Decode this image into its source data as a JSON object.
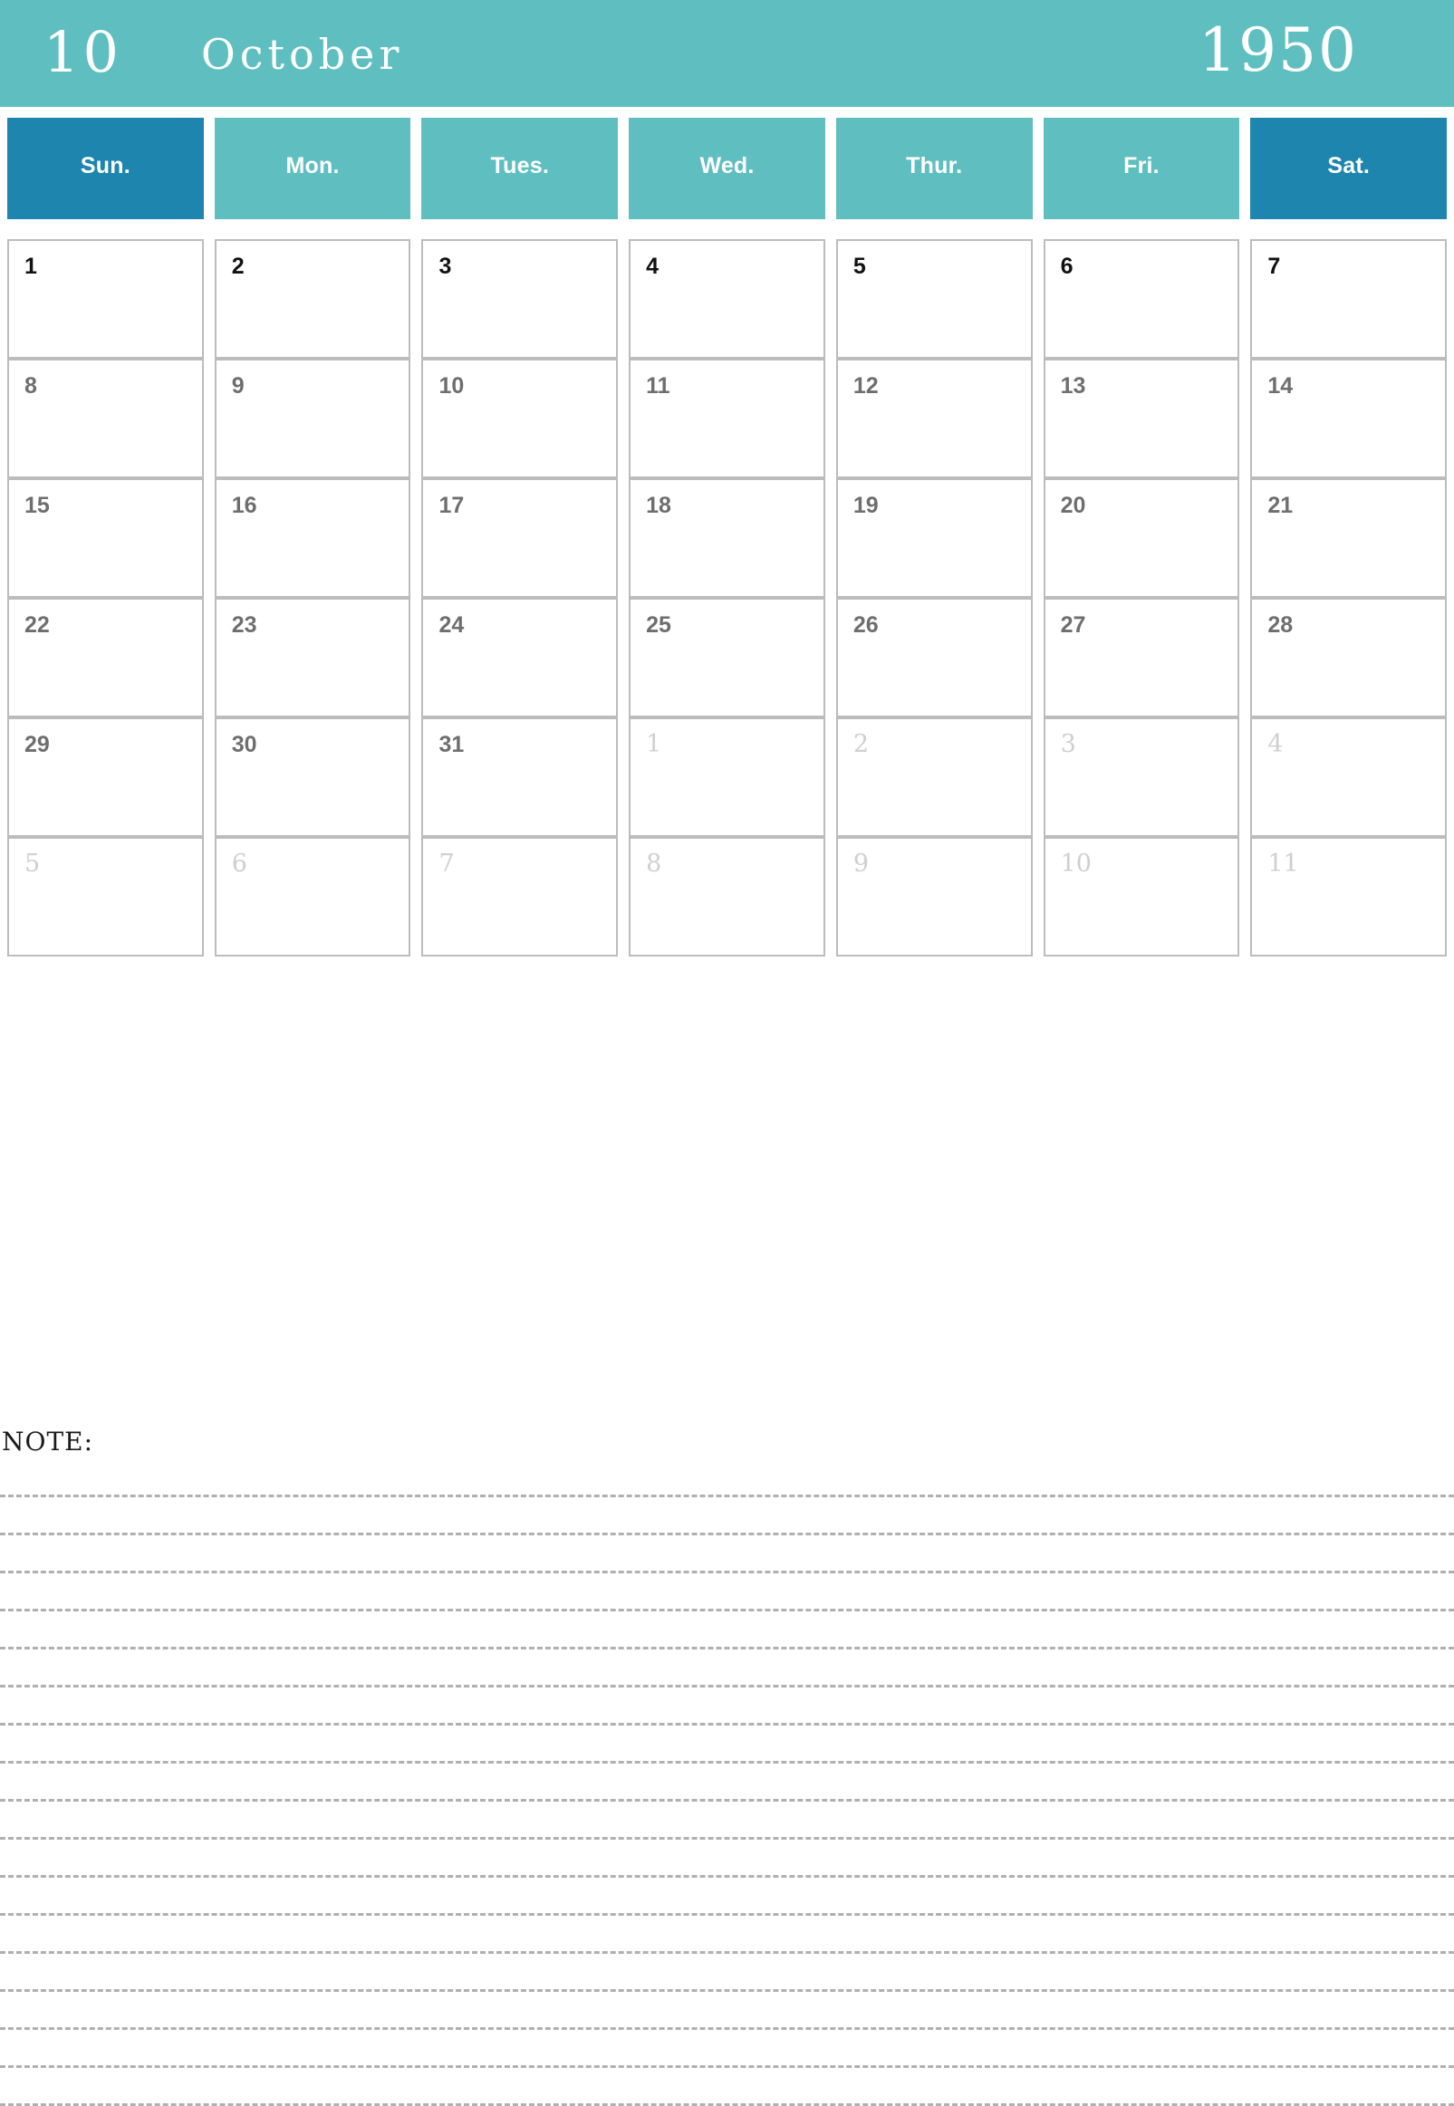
{
  "header": {
    "month_number": "10",
    "month_name": "October",
    "year": "1950",
    "background_color": "#5fbfc0",
    "text_color": "#ffffff"
  },
  "weekdays": [
    {
      "label": "Sun.",
      "weekend": true
    },
    {
      "label": "Mon.",
      "weekend": false
    },
    {
      "label": "Tues.",
      "weekend": false
    },
    {
      "label": "Wed.",
      "weekend": false
    },
    {
      "label": "Thur.",
      "weekend": false
    },
    {
      "label": "Fri.",
      "weekend": false
    },
    {
      "label": "Sat.",
      "weekend": true
    }
  ],
  "colors": {
    "teal": "#5fbfc0",
    "weekend_blue": "#1e86ae",
    "cell_border": "#bcbcbc",
    "date_current": "#6e6e6e",
    "date_first_row": "#111111",
    "date_other_month": "#cfcfcf",
    "note_line": "#b0b0b0"
  },
  "weeks": [
    [
      {
        "day": "1",
        "current_month": true
      },
      {
        "day": "2",
        "current_month": true
      },
      {
        "day": "3",
        "current_month": true
      },
      {
        "day": "4",
        "current_month": true
      },
      {
        "day": "5",
        "current_month": true
      },
      {
        "day": "6",
        "current_month": true
      },
      {
        "day": "7",
        "current_month": true
      }
    ],
    [
      {
        "day": "8",
        "current_month": true
      },
      {
        "day": "9",
        "current_month": true
      },
      {
        "day": "10",
        "current_month": true
      },
      {
        "day": "11",
        "current_month": true
      },
      {
        "day": "12",
        "current_month": true
      },
      {
        "day": "13",
        "current_month": true
      },
      {
        "day": "14",
        "current_month": true
      }
    ],
    [
      {
        "day": "15",
        "current_month": true
      },
      {
        "day": "16",
        "current_month": true
      },
      {
        "day": "17",
        "current_month": true
      },
      {
        "day": "18",
        "current_month": true
      },
      {
        "day": "19",
        "current_month": true
      },
      {
        "day": "20",
        "current_month": true
      },
      {
        "day": "21",
        "current_month": true
      }
    ],
    [
      {
        "day": "22",
        "current_month": true
      },
      {
        "day": "23",
        "current_month": true
      },
      {
        "day": "24",
        "current_month": true
      },
      {
        "day": "25",
        "current_month": true
      },
      {
        "day": "26",
        "current_month": true
      },
      {
        "day": "27",
        "current_month": true
      },
      {
        "day": "28",
        "current_month": true
      }
    ],
    [
      {
        "day": "29",
        "current_month": true
      },
      {
        "day": "30",
        "current_month": true
      },
      {
        "day": "31",
        "current_month": true
      },
      {
        "day": "1",
        "current_month": false
      },
      {
        "day": "2",
        "current_month": false
      },
      {
        "day": "3",
        "current_month": false
      },
      {
        "day": "4",
        "current_month": false
      }
    ],
    [
      {
        "day": "5",
        "current_month": false
      },
      {
        "day": "6",
        "current_month": false
      },
      {
        "day": "7",
        "current_month": false
      },
      {
        "day": "8",
        "current_month": false
      },
      {
        "day": "9",
        "current_month": false
      },
      {
        "day": "10",
        "current_month": false
      },
      {
        "day": "11",
        "current_month": false
      }
    ]
  ],
  "note": {
    "label": "NOTE:",
    "line_count": 17
  }
}
